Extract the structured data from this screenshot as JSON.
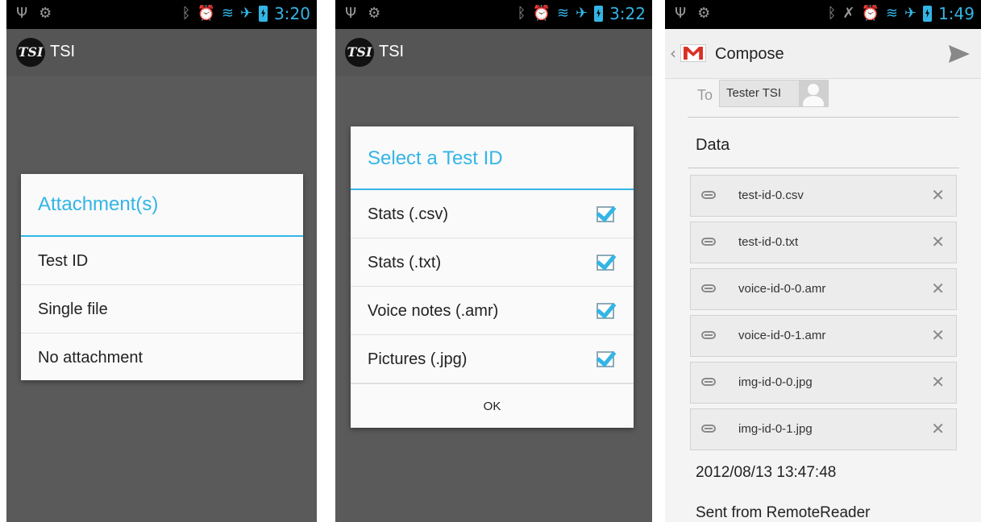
{
  "screens": [
    {
      "status": {
        "time": "3:20"
      },
      "app_title": "TSI",
      "dialog": {
        "title": "Attachment(s)",
        "items": [
          "Test ID",
          "Single file",
          "No attachment"
        ]
      }
    },
    {
      "status": {
        "time": "3:22"
      },
      "app_title": "TSI",
      "dialog": {
        "title": "Select a Test ID",
        "items": [
          {
            "label": "Stats (.csv)",
            "checked": true
          },
          {
            "label": "Stats (.txt)",
            "checked": true
          },
          {
            "label": "Voice notes (.amr)",
            "checked": true
          },
          {
            "label": "Pictures (.jpg)",
            "checked": true
          }
        ],
        "ok_label": "OK"
      }
    },
    {
      "status": {
        "time": "1:49"
      },
      "compose": {
        "title": "Compose",
        "to_label": "To",
        "recipient": "Tester TSI",
        "subject": "Data",
        "attachments": [
          "test-id-0.csv",
          "test-id-0.txt",
          "voice-id-0-0.amr",
          "voice-id-0-1.amr",
          "img-id-0-0.jpg",
          "img-id-0-1.jpg"
        ],
        "body_lines": [
          "2012/08/13 13:47:48",
          "Sent from RemoteReader"
        ]
      }
    }
  ],
  "icons": {
    "usb": "usb-icon",
    "android": "android-debug-icon",
    "bluetooth": "bluetooth-icon",
    "alarm": "alarm-icon",
    "wifi": "wifi-icon",
    "airplane": "airplane-icon",
    "battery": "battery-charging-icon",
    "send": "send-icon",
    "paperclip": "paperclip-icon",
    "remove": "close-icon"
  },
  "colors": {
    "accent": "#33b5e5",
    "gmail_red": "#d93025"
  }
}
